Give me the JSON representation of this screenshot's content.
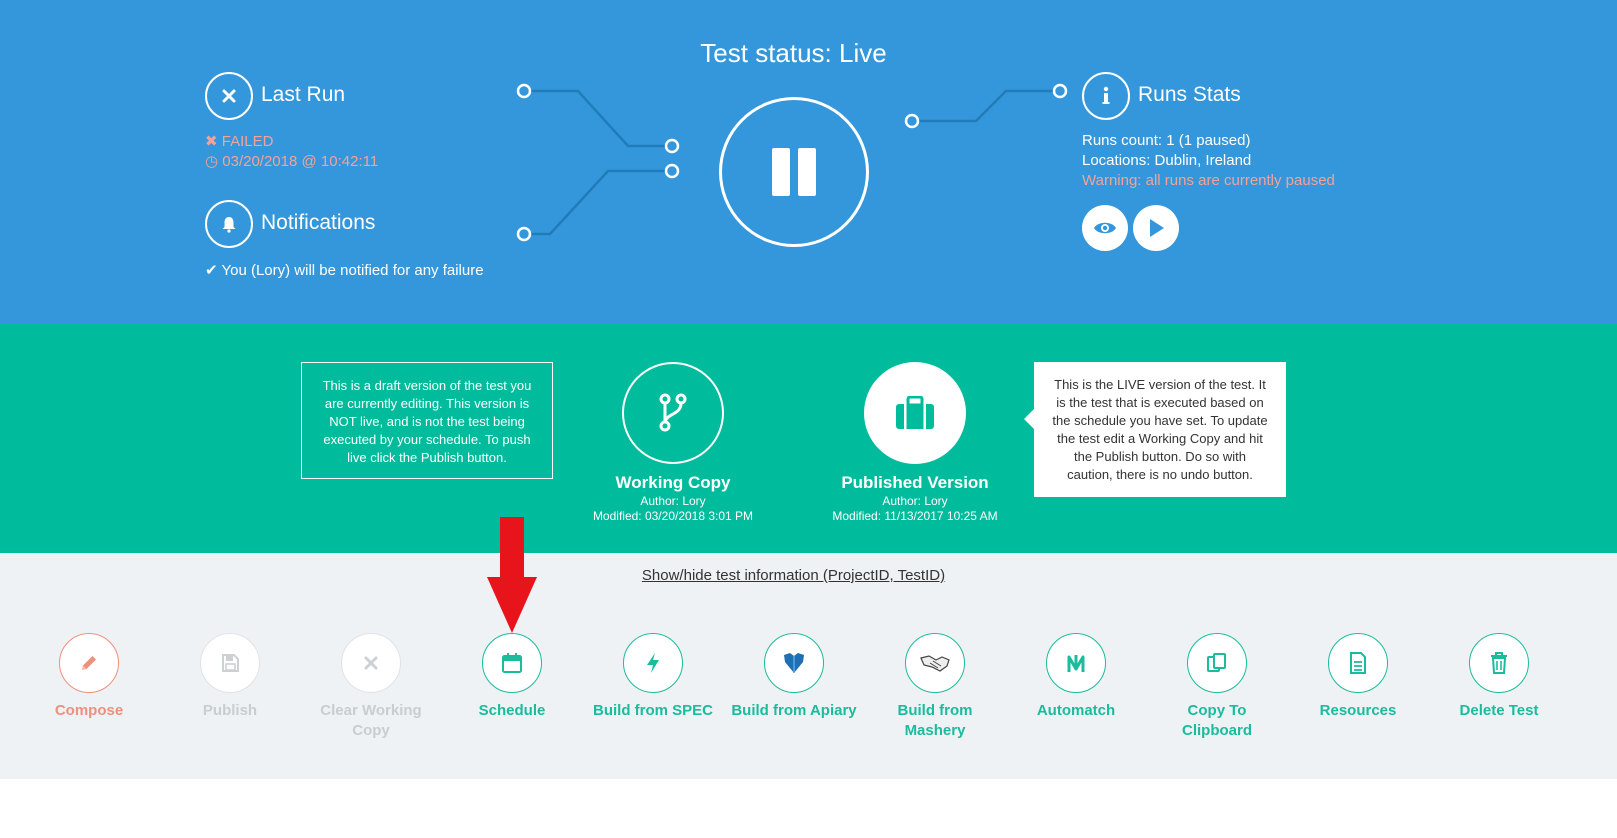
{
  "header": {
    "status_title": "Test status: Live"
  },
  "last_run": {
    "title": "Last Run",
    "status_icon": "x-icon",
    "result": "FAILED",
    "timestamp": "03/20/2018 @ 10:42:11"
  },
  "notifications": {
    "title": "Notifications",
    "icon": "bell-icon",
    "message": "You (Lory) will be notified for any failure"
  },
  "runs_stats": {
    "title": "Runs Stats",
    "icon": "info-icon",
    "runs_count": "Runs count: 1 (1 paused)",
    "locations": "Locations: Dublin, Ireland",
    "warning": "Warning: all runs are currently paused"
  },
  "versions": {
    "draft_help": "This is a draft version of the test you are currently editing. This version is NOT live, and is not the test being executed by your schedule. To push live click the Publish button.",
    "working_copy": {
      "title": "Working Copy",
      "author": "Author: Lory",
      "modified": "Modified: 03/20/2018 3:01 PM"
    },
    "published": {
      "title": "Published Version",
      "author": "Author: Lory",
      "modified": "Modified: 11/13/2017 10:25 AM"
    },
    "live_help": "This is the LIVE version of the test. It is the test that is executed based on the schedule you have set. To update the test edit a Working Copy and hit the Publish button. Do so with caution, there is no undo button."
  },
  "toggle_info_link": "Show/hide test information (ProjectID, TestID)",
  "actions": [
    {
      "label": "Compose",
      "icon": "pencil-icon"
    },
    {
      "label": "Publish",
      "icon": "save-icon"
    },
    {
      "label": "Clear Working Copy",
      "icon": "x-icon"
    },
    {
      "label": "Schedule",
      "icon": "calendar-icon"
    },
    {
      "label": "Build from SPEC",
      "icon": "bolt-icon"
    },
    {
      "label": "Build from Apiary",
      "icon": "apiary-icon"
    },
    {
      "label": "Build from Mashery",
      "icon": "handshake-icon"
    },
    {
      "label": "Automatch",
      "icon": "automatch-icon"
    },
    {
      "label": "Copy To Clipboard",
      "icon": "copy-icon"
    },
    {
      "label": "Resources",
      "icon": "document-icon"
    },
    {
      "label": "Delete Test",
      "icon": "trash-icon"
    }
  ],
  "colors": {
    "top_bg": "#3497db",
    "green_bg": "#00bc9c",
    "actions_bg": "#eef2f5",
    "accent": "#1abc9c",
    "compose": "#ef8f7e",
    "failed": "#f2a29a",
    "arrow": "#e8141c"
  }
}
